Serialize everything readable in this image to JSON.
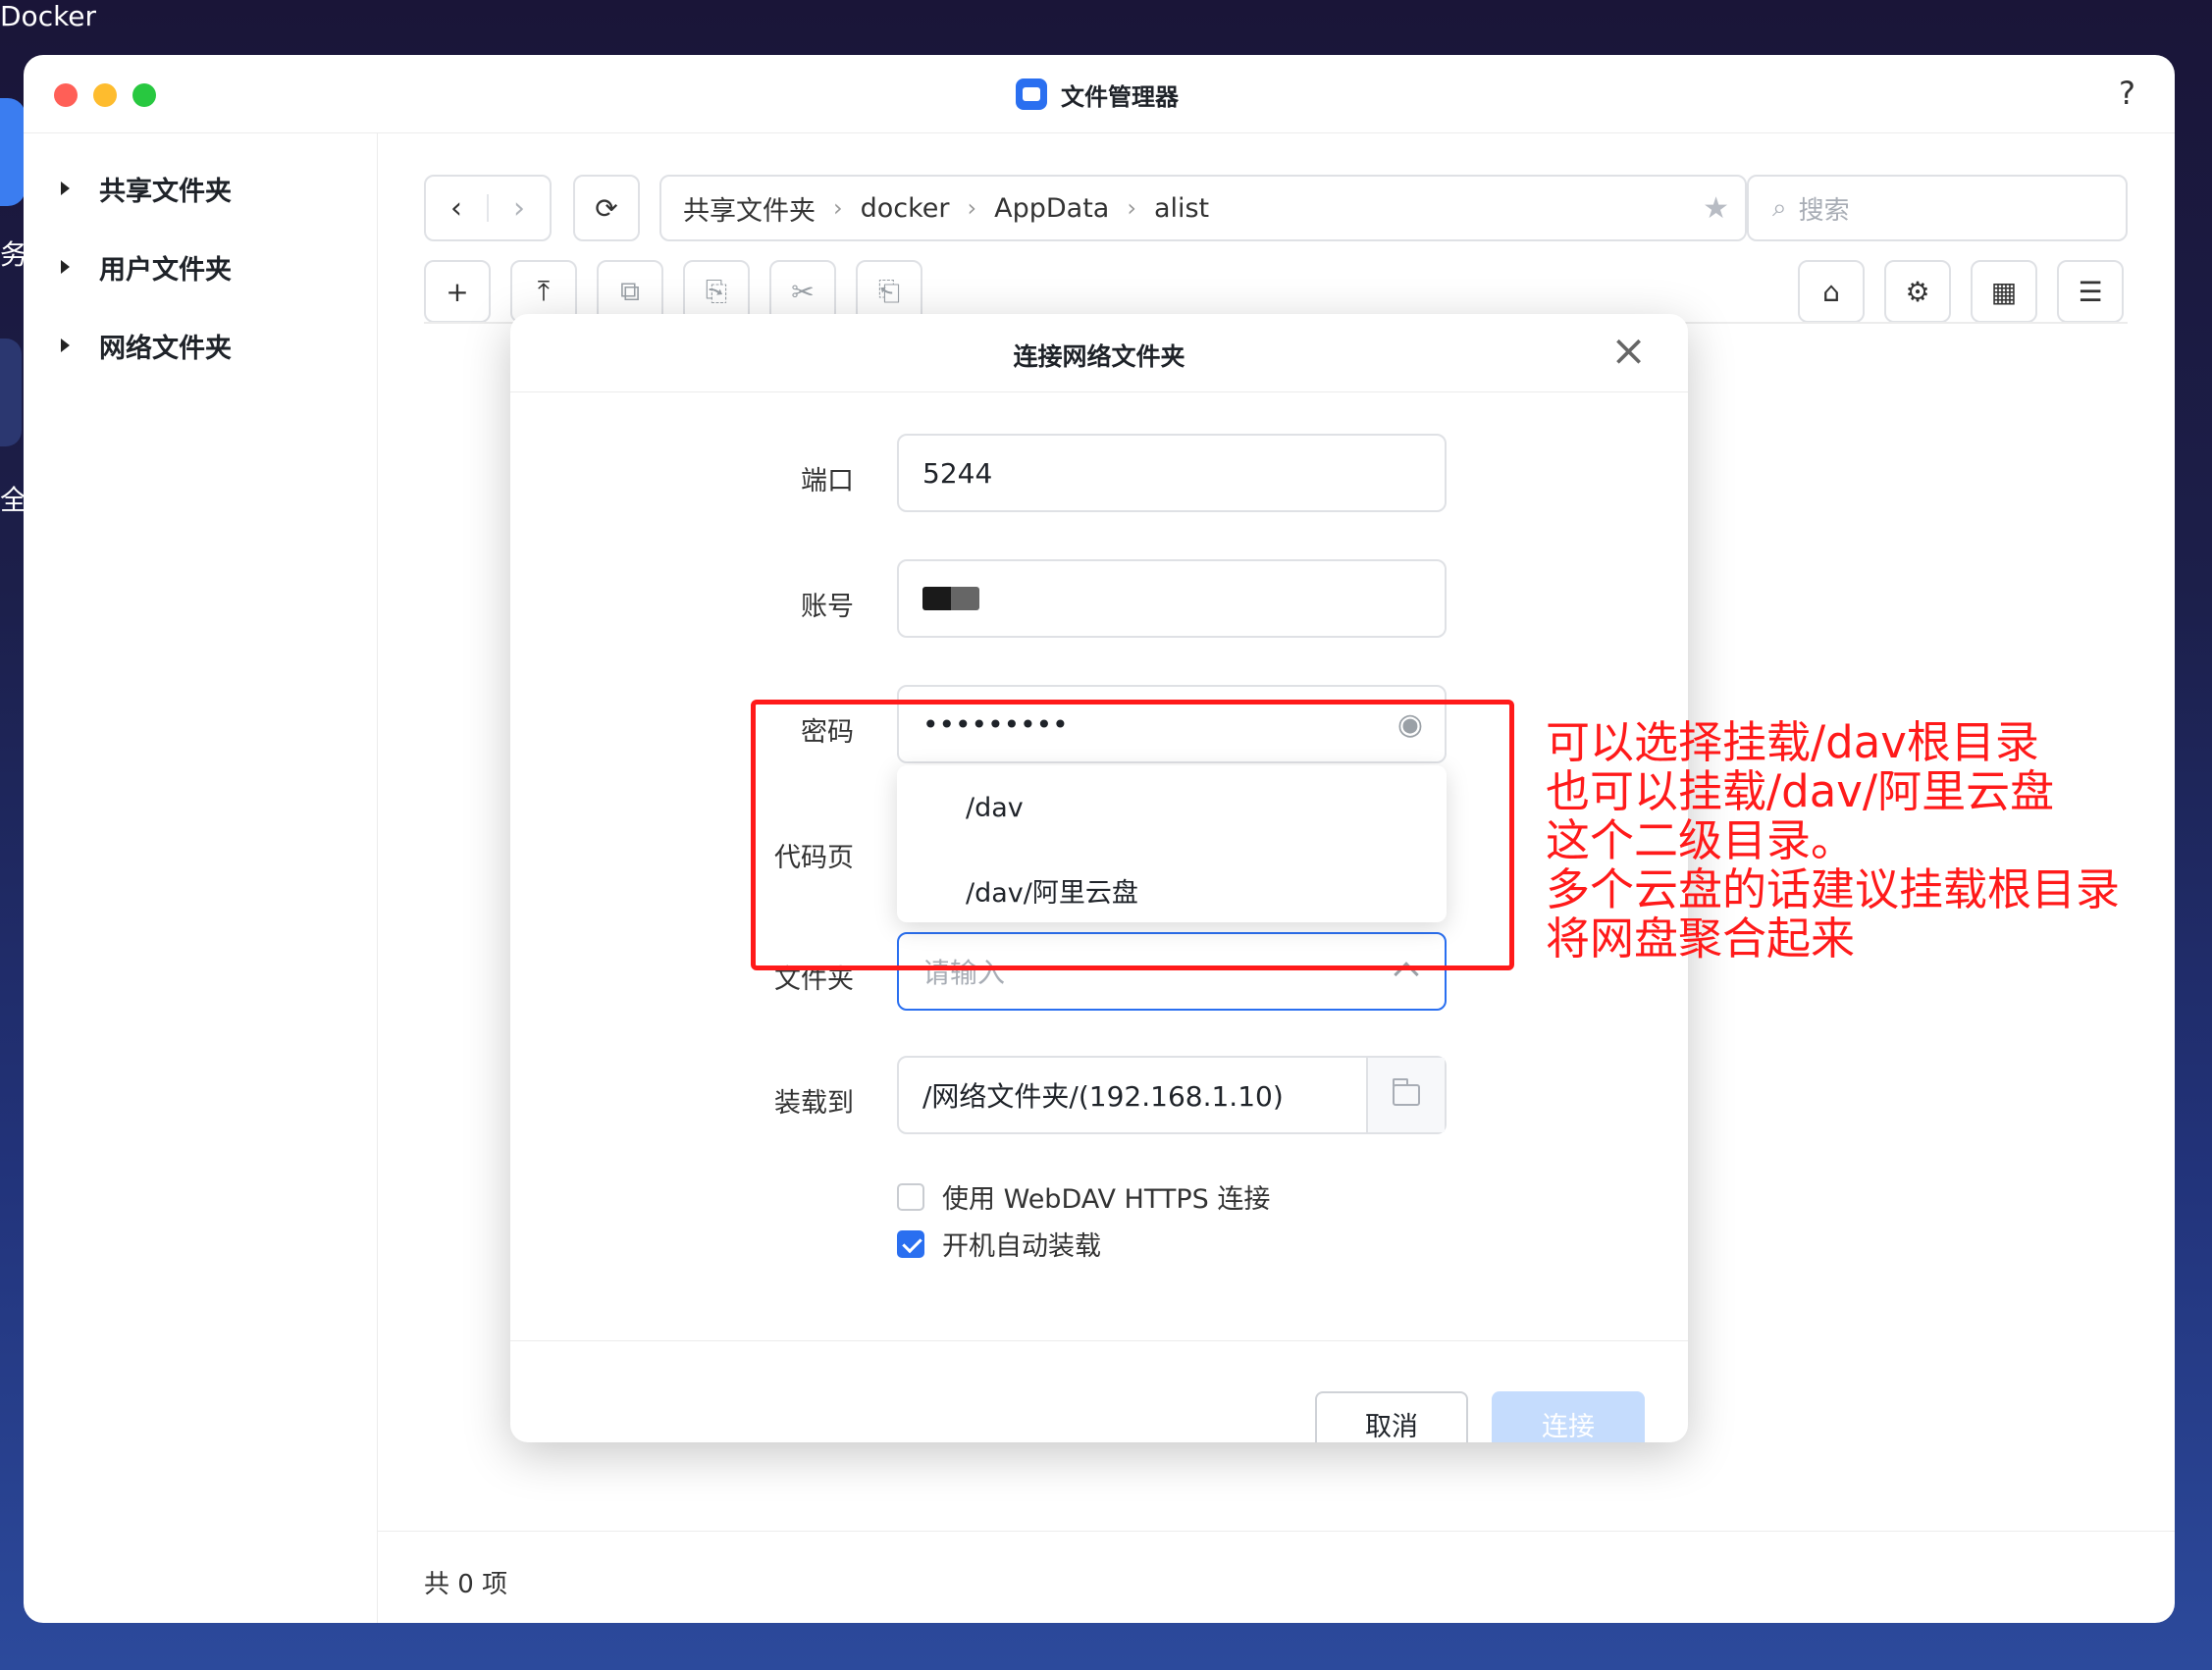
{
  "desktop": {
    "title": "Docker",
    "side_glyph_1": "务",
    "side_glyph_2": "全"
  },
  "window": {
    "app_title": "文件管理器",
    "help": "?"
  },
  "sidebar": {
    "items": [
      {
        "label": "共享文件夹"
      },
      {
        "label": "用户文件夹"
      },
      {
        "label": "网络文件夹"
      }
    ]
  },
  "toolbar": {
    "back_icon": "‹",
    "forward_icon": "›",
    "refresh_icon": "⟳",
    "breadcrumb": [
      "共享文件夹",
      "docker",
      "AppData",
      "alist"
    ],
    "breadcrumb_sep": "›",
    "star_icon": "★",
    "search_placeholder": "搜索",
    "search_icon": "⌕"
  },
  "actions": {
    "new_icon": "+",
    "upload_icon": "⤒",
    "copy_icon": "⧉",
    "paste_icon": "⎘",
    "cut_icon": "✂",
    "move_icon": "⎗",
    "drive_icon": "⌂",
    "settings_icon": "⚙",
    "grid_icon": "▦",
    "sort_icon": "☰"
  },
  "dialog": {
    "title": "连接网络文件夹",
    "close": "×",
    "port_label": "端口",
    "port_value": "5244",
    "account_label": "账号",
    "password_label": "密码",
    "password_value": "•••••••••",
    "eye_icon": "◉",
    "codepage_label": "代码页",
    "folder_label": "文件夹",
    "folder_placeholder": "请输入",
    "folder_options": [
      "/dav",
      "/dav/阿里云盘"
    ],
    "mount_label": "装载到",
    "mount_value": "/网络文件夹/(192.168.1.10)",
    "https_label": "使用 WebDAV HTTPS 连接",
    "https_checked": false,
    "automount_label": "开机自动装载",
    "automount_checked": true,
    "cancel": "取消",
    "connect": "连接"
  },
  "status": {
    "count_text": "共 0 项"
  },
  "annotation": {
    "text": "可以选择挂载/dav根目录\n也可以挂载/dav/阿里云盘\n这个二级目录。\n多个云盘的话建议挂载根目录\n将网盘聚合起来",
    "color": "#ff1a1a"
  },
  "colors": {
    "accent": "#2a6ff0",
    "annotation": "#ff1a1a"
  }
}
